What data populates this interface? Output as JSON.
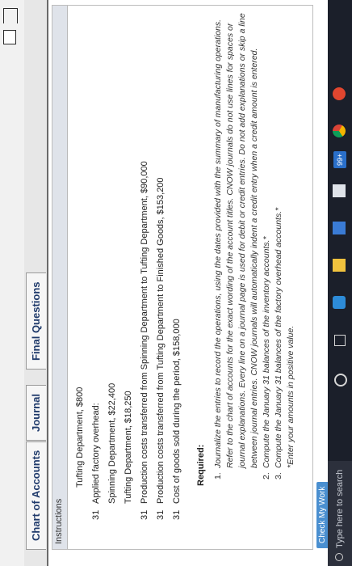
{
  "tabs": [
    {
      "label": "Chart of Accounts"
    },
    {
      "label": "Journal"
    },
    {
      "label": "Final Questions"
    }
  ],
  "instructions": {
    "heading": "Instructions",
    "entries": [
      {
        "day": "",
        "text": "Tufting Department, $800",
        "indent": true
      },
      {
        "day": "31",
        "text": "Applied factory overhead:",
        "indent": false
      },
      {
        "day": "",
        "text": "Spinning Department, $22,400",
        "indent": true
      },
      {
        "day": "",
        "text": "Tufting Department, $18,250",
        "indent": true
      },
      {
        "day": "31",
        "text": "Production costs transferred from Spinning Department to Tufting Department, $90,000",
        "indent": false
      },
      {
        "day": "31",
        "text": "Production costs transferred from Tufting Department to Finished Goods, $153,200",
        "indent": false
      },
      {
        "day": "31",
        "text": "Cost of goods sold during the period, $158,000",
        "indent": false
      }
    ],
    "required_label": "Required:",
    "requirements": [
      {
        "num": "1.",
        "text": "Journalize the entries to record the operations, using the dates provided with the summary of manufacturing operations. Refer to the chart of accounts for the exact wording of the account titles. CNOW journals do not use lines for spaces or journal explanations. Every line on a journal page is used for debit or credit entries. Do not add explanations or skip a line between journal entries. CNOW journals will automatically indent a credit entry when a credit amount is entered."
      },
      {
        "num": "2.",
        "text": "Compute the January 31 balances of the inventory accounts.*"
      },
      {
        "num": "3.",
        "text": "Compute the January 31 balances of the factory overhead accounts.*"
      },
      {
        "num": "",
        "text": "*Enter your amounts in positive value."
      }
    ]
  },
  "check_button": {
    "label": "Check My Work"
  },
  "taskbar": {
    "search_placeholder": "Type here to search",
    "badge": "99+"
  }
}
